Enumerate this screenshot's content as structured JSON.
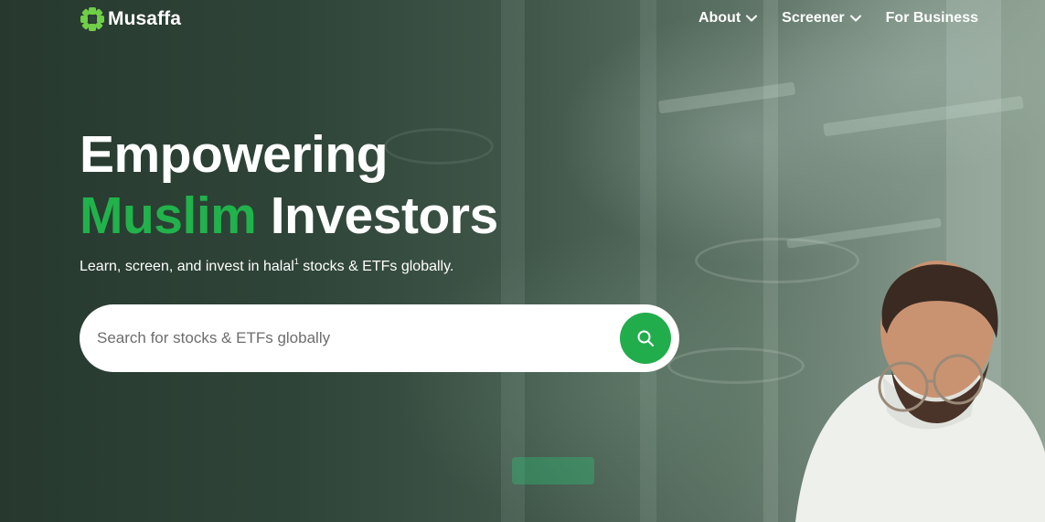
{
  "brand": {
    "name": "Musaffa",
    "accent_color": "#21b24b"
  },
  "nav": {
    "items": [
      {
        "label": "About",
        "icon": "chevron-down-icon"
      },
      {
        "label": "Screener",
        "icon": "chevron-down-icon"
      },
      {
        "label": "For Business"
      }
    ]
  },
  "hero": {
    "line1": "Empowering",
    "line2_accent": "Muslim",
    "line2_rest": "Investors",
    "subtitle_before": "Learn, screen, and invest in halal",
    "subtitle_sup": "1",
    "subtitle_after": " stocks & ETFs globally."
  },
  "search": {
    "placeholder": "Search for stocks & ETFs globally",
    "value": "",
    "button_icon": "search-icon",
    "button_color": "#22ad4c"
  }
}
